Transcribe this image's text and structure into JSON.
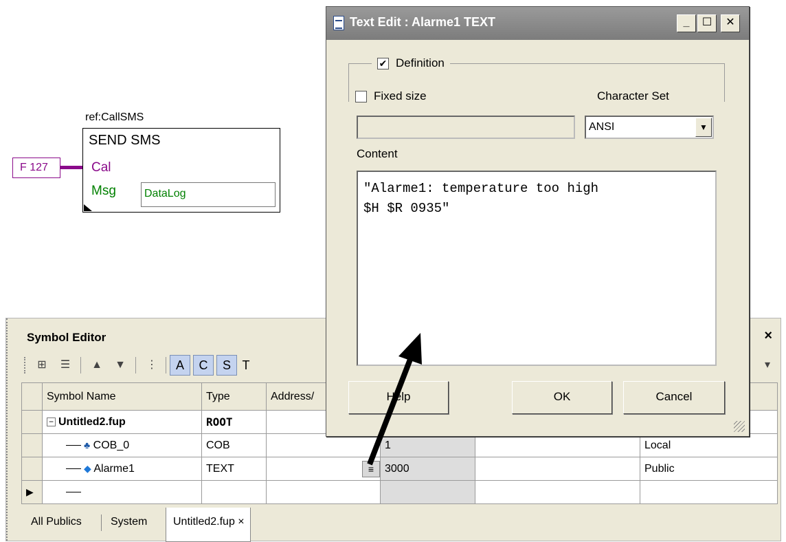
{
  "fup_block": {
    "ref_label": "ref:CallSMS",
    "title": "SEND SMS",
    "cal_pin": "Cal",
    "msg_pin": "Msg",
    "msg_value": "DataLog",
    "input_tag": "F 127"
  },
  "symbol_editor": {
    "title": "Symbol Editor",
    "close_glyph": "×",
    "toolbar": {
      "icons": [
        "tree-view-icon",
        "list-view-icon",
        "arrow-up-icon",
        "arrow-down-icon",
        "indent-icon"
      ],
      "letters": [
        "A",
        "C",
        "S",
        "T"
      ]
    },
    "columns": [
      "Symbol Name",
      "Type",
      "Address/",
      "",
      "",
      ""
    ],
    "rows": [
      {
        "name": "Untitled2.fup",
        "type": "ROOT",
        "address": "",
        "value": "",
        "comment": "",
        "scope": ""
      },
      {
        "name": "COB_0",
        "type": "COB",
        "address": "",
        "value": "1",
        "comment": "",
        "scope": "Local"
      },
      {
        "name": "Alarme1",
        "type": "TEXT",
        "address": "",
        "value": "3000",
        "comment": "",
        "scope": "Public"
      }
    ],
    "tabs": [
      "All Publics",
      "System",
      "Untitled2.fup ×"
    ]
  },
  "dialog": {
    "title": "Text Edit : Alarme1 TEXT",
    "min_glyph": "_",
    "max_glyph": "☐",
    "close_glyph": "✕",
    "definition_label": "Definition",
    "definition_checked": "✔",
    "fixed_size_label": "Fixed size",
    "charset_label": "Character Set",
    "charset_value": "ANSI",
    "content_label": "Content",
    "content_text": "\"Alarme1: temperature too high\n$H $R 0935\"",
    "buttons": {
      "help": "Help",
      "ok": "OK",
      "cancel": "Cancel"
    }
  },
  "colors": {
    "fup_purple": "#8a0a8a",
    "fup_green": "#008000",
    "title_bar_inactive": "#8a8a8a",
    "panel_bg": "#ece9d8"
  }
}
